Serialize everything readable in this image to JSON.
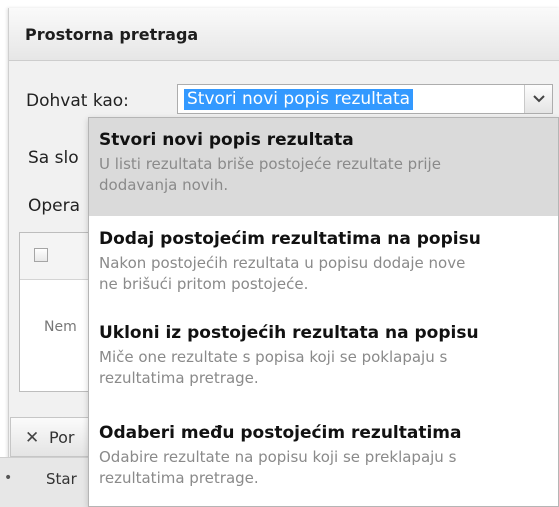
{
  "panel": {
    "title": "Prostorna pretraga"
  },
  "form": {
    "fetch_label": "Dohvat kao:",
    "fetch_value": "Stvori novi popis rezultata",
    "layers_label": "Sa slo",
    "operation_label": "Opera"
  },
  "grid": {
    "empty_text": "Nem"
  },
  "bottom": {
    "button_label": "Por",
    "status_label": "Star"
  },
  "icons": {
    "dropdown_arrow": "chevron-down-icon",
    "close": "close-icon",
    "checkbox": "checkbox-icon"
  },
  "colors": {
    "selection": "#3399ff",
    "hover_option": "#dadada",
    "description_text": "#8a8a8a"
  },
  "dropdown": {
    "options": [
      {
        "title": "Stvori novi popis rezultata",
        "desc1": "U listi rezultata briše postojeće rezultate prije",
        "desc2": "dodavanja novih."
      },
      {
        "title": "Dodaj postojećim rezultatima na popisu",
        "desc1": "Nakon postojećih rezultata u popisu dodaje nove",
        "desc2": "ne brišući pritom postojeće."
      },
      {
        "title": "Ukloni iz postojećih rezultata na popisu",
        "desc1": "Miče one rezultate s popisa koji se poklapaju s",
        "desc2": "rezultatima pretrage."
      },
      {
        "title": "Odaberi među postojećim rezultatima",
        "desc1": "Odabire rezultate na popisu koji se preklapaju s",
        "desc2": "rezultatima pretrage."
      }
    ]
  }
}
